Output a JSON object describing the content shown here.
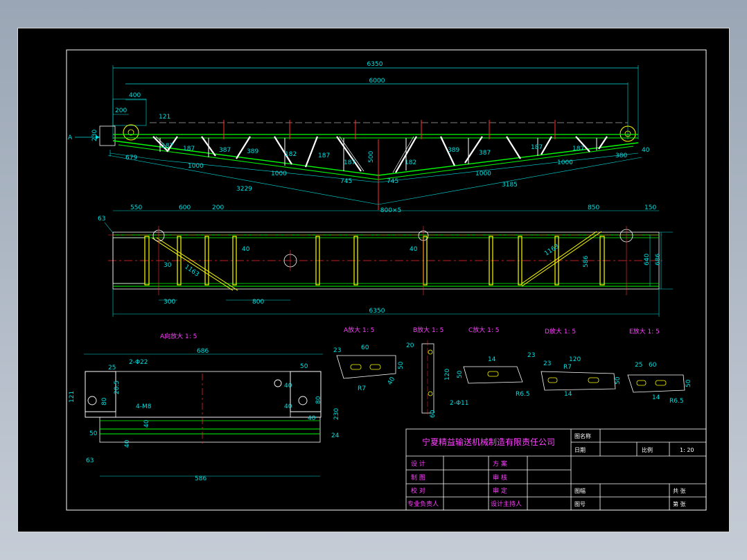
{
  "company": "宁夏精益输送机械制造有限责任公司",
  "arrow_label": "A",
  "top_view": {
    "dims_top": [
      "6350",
      "6000",
      "400",
      "200",
      "121",
      "230"
    ],
    "dims_bottom": [
      "679",
      "1000",
      "1000",
      "1000",
      "1000",
      "380",
      "40",
      "3229",
      "3185",
      "745",
      "745",
      "500"
    ],
    "member_dims": [
      "187",
      "187",
      "387",
      "389",
      "182",
      "187",
      "187",
      "182",
      "389",
      "387",
      "187",
      "187"
    ]
  },
  "plan_view": {
    "dims_top": [
      "550",
      "600",
      "200",
      "800×5",
      "850",
      "150"
    ],
    "dims_left": [
      "63"
    ],
    "dims_inner": [
      "40",
      "40",
      "30",
      "1163",
      "1163",
      "586"
    ],
    "dims_right": [
      "640",
      "686"
    ],
    "dims_bottom": [
      "300",
      "800",
      "6350"
    ]
  },
  "detail_a": {
    "title": "A向放大 1: 5",
    "dims": [
      "686",
      "25",
      "2-Φ22",
      "20.5",
      "121",
      "80",
      "4-M8",
      "50",
      "40",
      "80",
      "40",
      "230",
      "50",
      "40",
      "24",
      "63",
      "586",
      "40",
      "40"
    ]
  },
  "detail_views": [
    {
      "title": "A放大 1: 5",
      "dims": [
        "23",
        "60",
        "50",
        "R7",
        "40"
      ]
    },
    {
      "title": "B放大 1: 5",
      "dims": [
        "20",
        "120",
        "2-Φ11",
        "60"
      ]
    },
    {
      "title": "C放大 1: 5",
      "dims": [
        "14",
        "50",
        "23",
        "R6.5"
      ]
    },
    {
      "title": "D放大 1: 5",
      "dims": [
        "23",
        "120",
        "R7",
        "14",
        "50"
      ]
    },
    {
      "title": "E放大 1: 5",
      "dims": [
        "25",
        "60",
        "50",
        "14",
        "R6.5"
      ]
    }
  ],
  "title_block": {
    "fields": {
      "drawing_name": "图名称",
      "date": "日期",
      "scale_label": "比例",
      "scale_value": "1: 20",
      "designer": "设  计",
      "drafter": "制  图",
      "checker": "校  对",
      "responsible": "专业负责人",
      "scheme": "方  案",
      "reviewer": "审  核",
      "examiner": "审  定",
      "chief": "设计主持人",
      "size": "图幅",
      "number": "图号",
      "total_sheets": "共  张",
      "sheet_no": "第  张"
    }
  }
}
